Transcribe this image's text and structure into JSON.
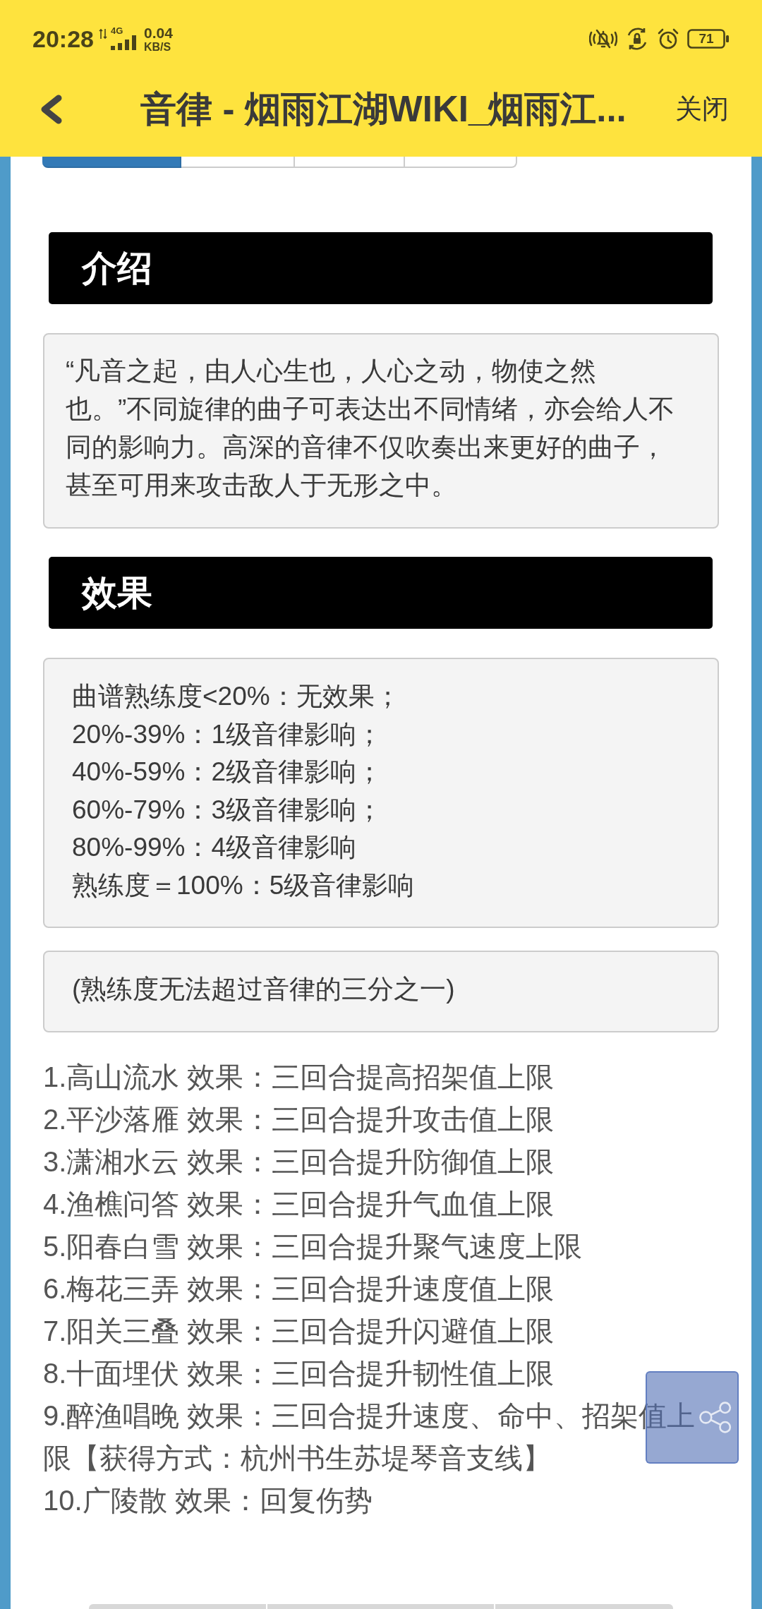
{
  "status_bar": {
    "time": "20:28",
    "network": "4G",
    "speed_value": "0.04",
    "speed_unit": "KB/S",
    "battery": "71"
  },
  "header": {
    "title": "音律 - 烟雨江湖WIKI_烟雨江...",
    "close_button": "关闭"
  },
  "tabs": [
    {
      "selected": true
    },
    {
      "selected": false
    },
    {
      "selected": false
    },
    {
      "selected": false
    }
  ],
  "content": [
    {
      "kind": "heading",
      "text": "介绍"
    },
    {
      "kind": "paragraph_box",
      "text": "“凡音之起，由人心生也，人心之动，物使之然也。”不同旋律的曲子可表达出不同情绪，亦会给人不同的影响力。高深的音律不仅吹奏出来更好的曲子，甚至可用来攻击敌人于无形之中。"
    },
    {
      "kind": "heading",
      "text": "效果"
    },
    {
      "kind": "lines_box",
      "lines": [
        "曲谱熟练度<20%：无效果；",
        "20%-39%：1级音律影响；",
        "40%-59%：2级音律影响；",
        "60%-79%：3级音律影响；",
        "80%-99%：4级音律影响",
        "熟练度＝100%：5级音律影响"
      ]
    },
    {
      "kind": "lines_box",
      "lines": [
        "(熟练度无法超过音律的三分之一)"
      ]
    },
    {
      "kind": "list",
      "items": [
        "1.高山流水 效果：三回合提高招架值上限",
        "2.平沙落雁 效果：三回合提升攻击值上限",
        "3.潇湘水云 效果：三回合提升防御值上限",
        "4.渔樵问答 效果：三回合提升气血值上限",
        "5.阳春白雪 效果：三回合提升聚气速度上限",
        "6.梅花三弄 效果：三回合提升速度值上限",
        "7.阳关三叠 效果：三回合提升闪避值上限",
        "8.十面埋伏 效果：三回合提升韧性值上限",
        "9.醉渔唱晚 效果：三回合提升速度、命中、招架值上限【获得方式：杭州书生苏堤琴音支线】",
        "10.广陵散 效果：回复伤势"
      ]
    }
  ]
}
